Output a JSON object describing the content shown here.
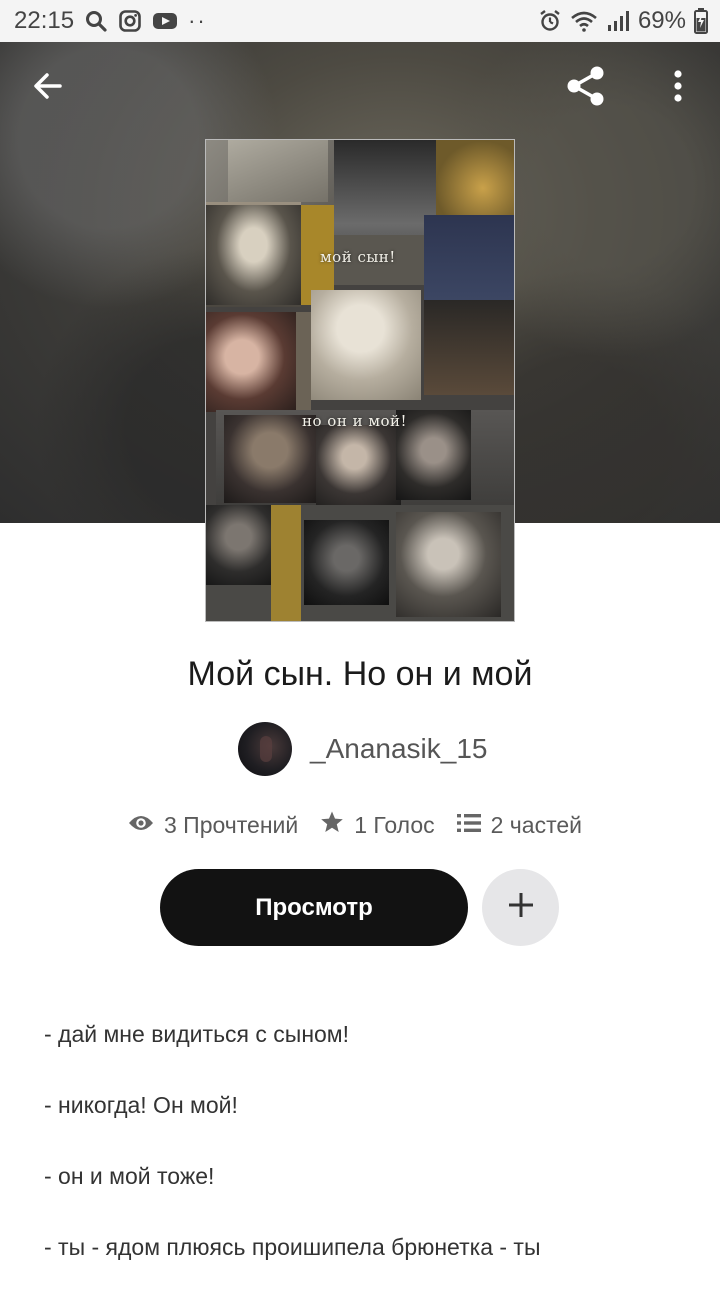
{
  "status_bar": {
    "time": "22:15",
    "dots": "··",
    "battery": "69%"
  },
  "header": {
    "back_icon": "arrow-left-icon",
    "share_icon": "share-icon",
    "more_icon": "more-vertical-icon"
  },
  "cover": {
    "text_top": "мой сын!",
    "text_middle": "но он и мой!"
  },
  "story": {
    "title": "Мой сын. Но он и мой",
    "author": "_Ananasik_15",
    "reads": "3 Прочтений",
    "votes": "1 Голос",
    "parts": "2 частей"
  },
  "actions": {
    "read_label": "Просмотр",
    "add_icon": "plus-icon"
  },
  "description": [
    "- дай мне видиться с сыном!",
    "- никогда! Он мой!",
    "- он и мой тоже!",
    "- ты - ядом плюясь проишипела брюнетка - ты"
  ]
}
